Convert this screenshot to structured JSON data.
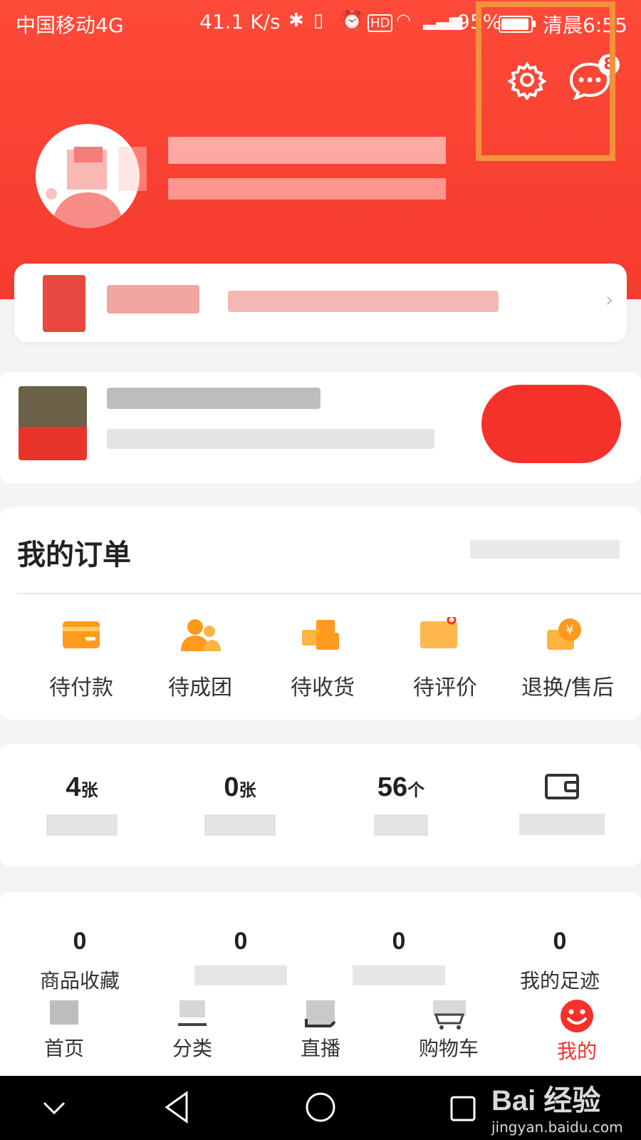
{
  "status_bar": {
    "carrier": "中国移动4G",
    "speed": "41.1 K/s",
    "battery": "95%",
    "time": "清晨6:55"
  },
  "header": {
    "message_badge": "8",
    "highlight_color": "#f2923a"
  },
  "colors": {
    "brand_red": "#f53b2e",
    "orange": "#ff9a1f",
    "tab_active": "#f5322a"
  },
  "orders": {
    "title": "我的订单",
    "items": [
      {
        "label": "待付款",
        "icon": "wallet-icon"
      },
      {
        "label": "待成团",
        "icon": "group-icon"
      },
      {
        "label": "待收货",
        "icon": "package-icon"
      },
      {
        "label": "待评价",
        "icon": "comment-icon"
      },
      {
        "label": "退换/售后",
        "icon": "refund-icon"
      }
    ]
  },
  "assets": [
    {
      "num": "4",
      "unit": "张"
    },
    {
      "num": "0",
      "unit": "张"
    },
    {
      "num": "56",
      "unit": "个"
    },
    {
      "num": "",
      "unit": "",
      "icon": "wallet-outline-icon"
    }
  ],
  "favorites": [
    {
      "num": "0",
      "label": "商品收藏"
    },
    {
      "num": "0",
      "label": ""
    },
    {
      "num": "0",
      "label": ""
    },
    {
      "num": "0",
      "label": "我的足迹"
    }
  ],
  "tabbar": {
    "items": [
      {
        "label": "首页",
        "icon": "home-icon"
      },
      {
        "label": "分类",
        "icon": "category-icon"
      },
      {
        "label": "直播",
        "icon": "live-icon"
      },
      {
        "label": "购物车",
        "icon": "cart-icon"
      },
      {
        "label": "我的",
        "icon": "smile-icon",
        "active": true
      }
    ]
  },
  "watermark": {
    "brand": "Bai 经验",
    "url": "jingyan.baidu.com"
  }
}
